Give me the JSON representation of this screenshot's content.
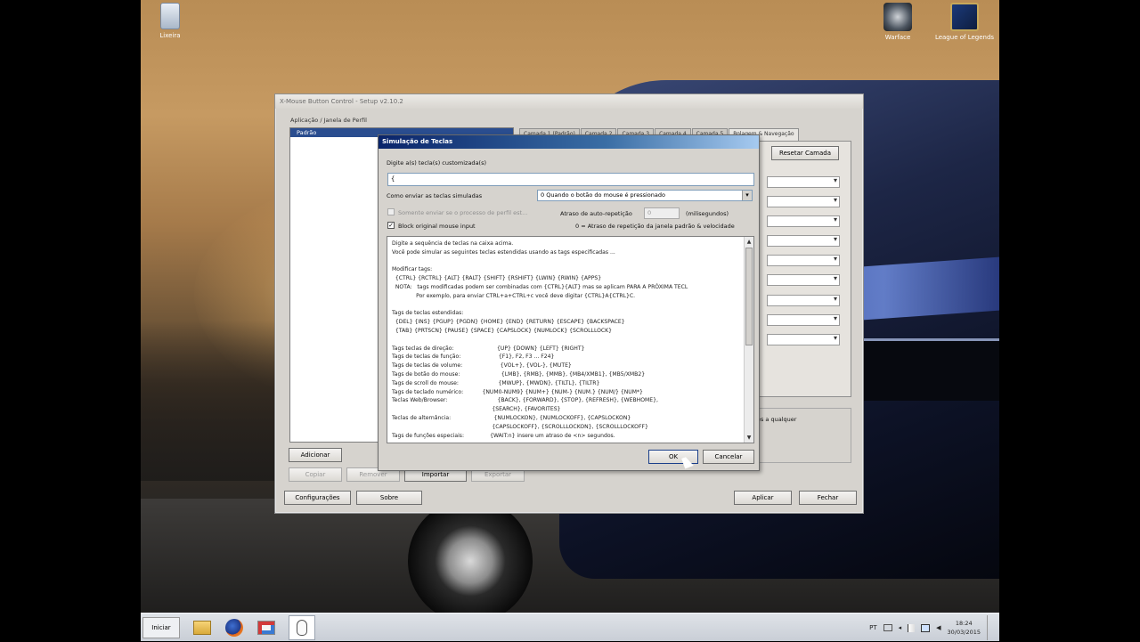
{
  "desktop": {
    "icons": [
      {
        "label": "Lixeira",
        "icon": "recycle-bin-icon"
      },
      {
        "label": "Warface",
        "icon": "warface-icon"
      },
      {
        "label": "League of Legends",
        "icon": "league-of-legends-icon"
      }
    ]
  },
  "main_window": {
    "title": "X-Mouse Button Control - Setup v2.10.2",
    "profile_section_label": "Aplicação / Janela de Perfil",
    "profiles": [
      "Padrão"
    ],
    "tabs": [
      "Camada 1 (Padrão)",
      "Camada 2",
      "Camada 3",
      "Camada 4",
      "Camada 5",
      "Rolagem & Navegação"
    ],
    "reset_layer_button": "Resetar Camada",
    "add_button": "Adicionar",
    "copy_button": "Copiar",
    "remove_button": "Remover",
    "import_button": "Importar",
    "export_button": "Exportar",
    "settings_button": "Configurações",
    "about_button": "Sobre",
    "apply_button": "Aplicar",
    "close_button": "Fechar",
    "partial_text": "ões a qualquer"
  },
  "dialog": {
    "title": "Simulação de Teclas",
    "keys_label": "Digite a(s) tecla(s) customizada(s)",
    "keys_value": "{",
    "send_mode_label": "Como enviar as teclas simuladas",
    "send_mode_value": "0 Quando o botão do mouse é pressionado",
    "disabled_option_label": "Somente enviar se o processo de perfil est...",
    "repeat_delay_label": "Atraso de auto-repetição",
    "repeat_delay_value": "0",
    "repeat_unit": "(milisegundos)",
    "block_input_label": "Block original mouse input",
    "block_input_checked": true,
    "repeat_hint": "0 = Atraso de repetição da janela padrão & velocidade",
    "help_lines": [
      "Digite a sequência de teclas na caixa acima.",
      "Você pode simular as seguintes teclas estendidas usando as tags especificadas ...",
      "",
      "Modificar tags:",
      "  {CTRL} {RCTRL} {ALT} {RALT} {SHIFT} {RSHIFT} {LWIN} {RWIN} {APPS}",
      "  NOTA:   tags modificadas podem ser combinadas com {CTRL}{ALT} mas se aplicam PARA A PRÓXIMA TECL",
      "              Por exemplo, para enviar CTRL+a+CTRL+c você deve digitar {CTRL}A{CTRL}C.",
      "",
      "Tags de teclas estendidas:",
      "  {DEL} {INS} {PGUP} {PGDN} {HOME} {END} {RETURN} {ESCAPE} {BACKSPACE}",
      "  {TAB} {PRTSCN} {PAUSE} {SPACE} {CAPSLOCK} {NUMLOCK} {SCROLLLOCK}",
      "",
      "Tags teclas de direção:                         {UP} {DOWN} {LEFT} {RIGHT}",
      "Tags de teclas de função:                      {F1}, F2, F3 ... F24}",
      "Tags de teclas de volume:                      {VOL+}, {VOL-}, {MUTE}",
      "Tags de botão do mouse:                        {LMB}, {RMB}, {MMB}, {MB4/XMB1}, {MB5/XMB2}",
      "Tags de scroll do mouse:                       {MWUP}, {MWDN}, {TILTL}, {TILTR}",
      "Tags de teclado numérico:           {NUM0-NUM9} {NUM+} {NUM-} {NUM.} {NUM/} {NUM*}",
      "Teclas Web/Browser:                             {BACK}, {FORWARD}, {STOP}, {REFRESH}, {WEBHOME},",
      "                                                          {SEARCH}, {FAVORITES}",
      "Teclas de alternância:                         {NUMLOCKON}, {NUMLOCKOFF}, {CAPSLOCKON}",
      "                                                          {CAPSLOCKOFF}, {SCROLLLOCKON}, {SCROLLLOCKOFF}",
      "Tags de funções especiais:               {WAIT:n} insere um atraso de <n> segundos."
    ],
    "ok_button": "OK",
    "cancel_button": "Cancelar"
  },
  "taskbar": {
    "start_label": "Iniciar",
    "apps": [
      "explorer-icon",
      "firefox-icon",
      "paint-icon",
      "xmouse-icon"
    ],
    "language": "PT",
    "time": "18:24",
    "date": "30/03/2015"
  }
}
